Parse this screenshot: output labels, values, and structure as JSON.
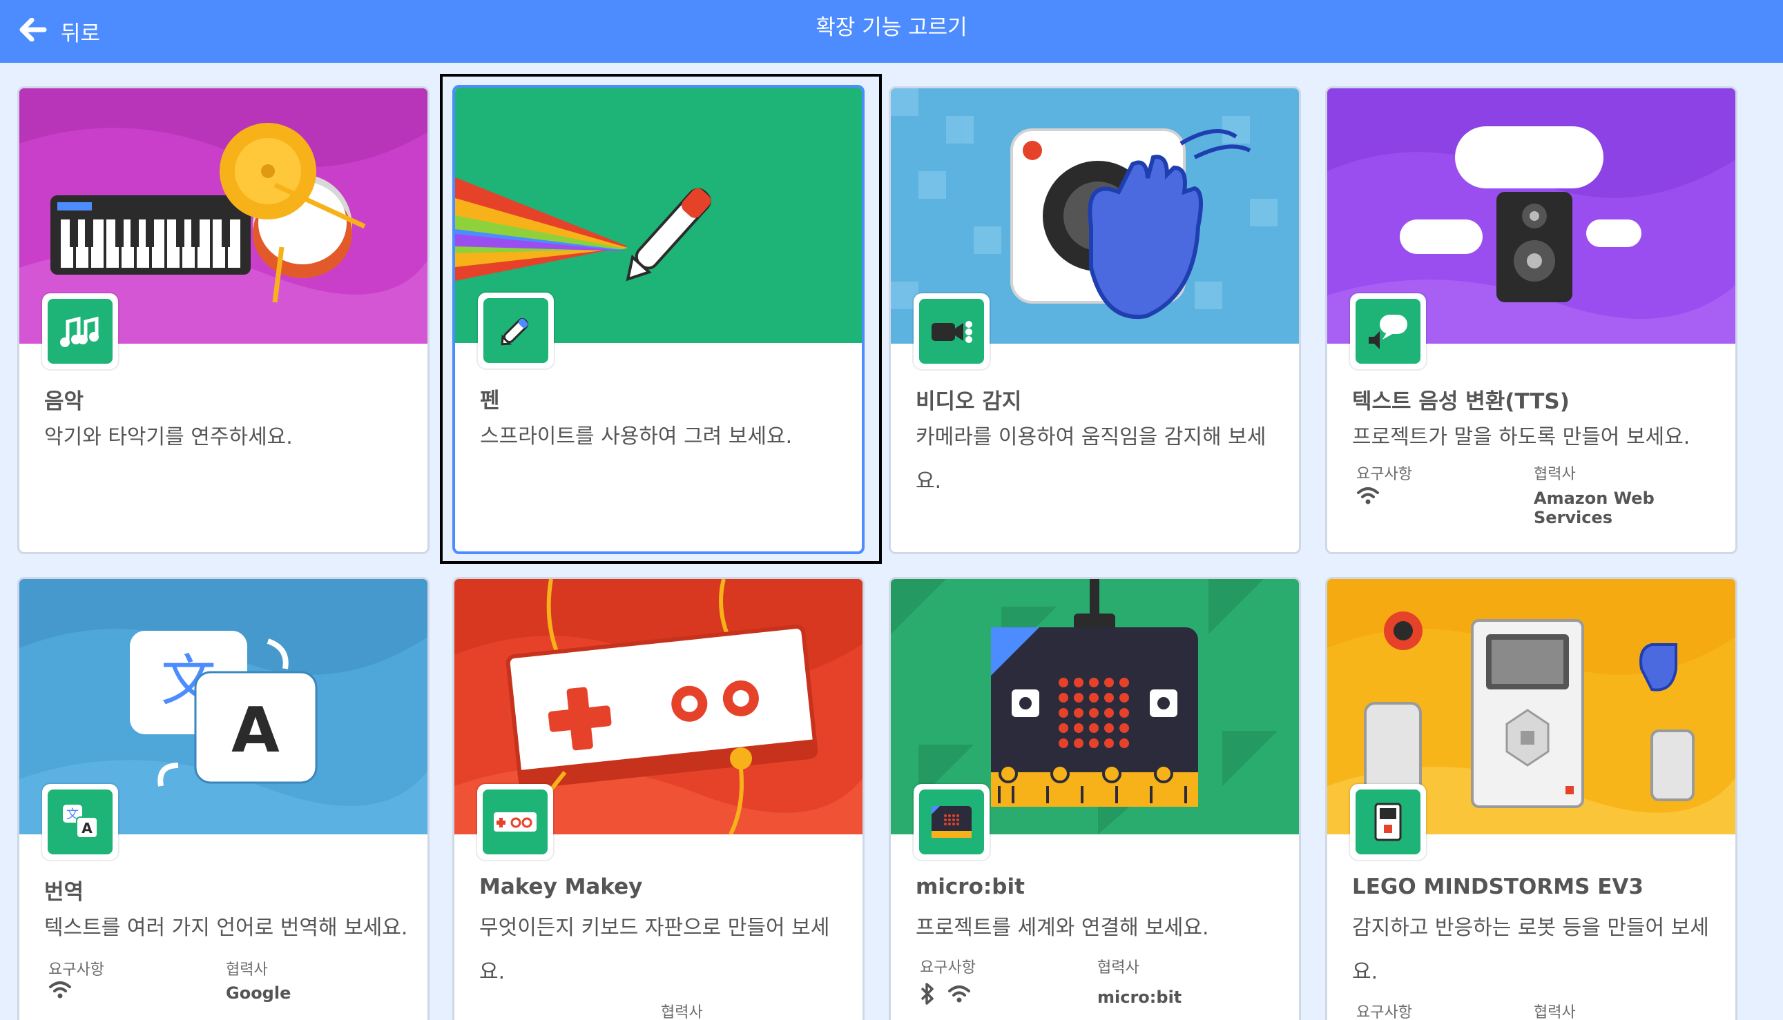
{
  "header": {
    "back_label": "뒤로",
    "title": "확장 기능 고르기"
  },
  "colors": {
    "header": "#4c8cff",
    "background": "#e6f0ff",
    "accent": "#4c8cff"
  },
  "extensions": [
    {
      "name": "음악",
      "description": "악기와 타악기를 연주하세요.",
      "icon": "music-notes-icon",
      "theme": "#c93fc9"
    },
    {
      "name": "펜",
      "description": "스프라이트를 사용하여 그려 보세요.",
      "icon": "pen-icon",
      "theme": "#1eb377",
      "selected": true
    },
    {
      "name": "비디오 감지",
      "description": "카메라를 이용하여 움직임을 감지해 보세요.",
      "icon": "video-camera-icon",
      "theme": "#5cb3e0"
    },
    {
      "name": "텍스트 음성 변환(TTS)",
      "description": "프로젝트가 말을 하도록 만들어 보세요.",
      "icon": "speech-bubble-icon",
      "theme": "#9b4ef0",
      "requirements_label": "요구사항",
      "collaborator_label": "협력사",
      "collaborator": "Amazon Web Services",
      "requirements": [
        "wifi-icon"
      ]
    },
    {
      "name": "번역",
      "description": "텍스트를 여러 가지 언어로 번역해 보세요.",
      "icon": "translate-icon",
      "theme": "#4ea6d9",
      "requirements_label": "요구사항",
      "collaborator_label": "협력사",
      "collaborator": "Google",
      "requirements": [
        "wifi-icon"
      ]
    },
    {
      "name": "Makey Makey",
      "description": "무엇이든지 키보드 자판으로 만들어 보세요.",
      "icon": "makey-makey-icon",
      "theme": "#e6422a",
      "collaborator_label": "협력사"
    },
    {
      "name": "micro:bit",
      "description": "프로젝트를 세계와 연결해 보세요.",
      "icon": "microbit-icon",
      "theme": "#2aac6f",
      "requirements_label": "요구사항",
      "collaborator_label": "협력사",
      "collaborator": "micro:bit",
      "requirements": [
        "bluetooth-icon",
        "wifi-icon"
      ]
    },
    {
      "name": "LEGO MINDSTORMS EV3",
      "description": "감지하고 반응하는 로봇 등을 만들어 보세요.",
      "icon": "ev3-brick-icon",
      "theme": "#f8b51a",
      "requirements_label": "요구사항",
      "collaborator_label": "협력사"
    }
  ]
}
